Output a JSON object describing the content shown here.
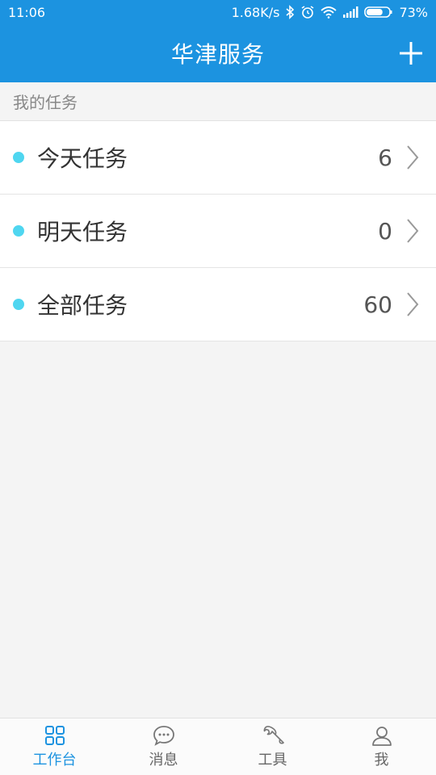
{
  "status_bar": {
    "time": "11:06",
    "network_speed": "1.68K/s",
    "battery": "73%",
    "battery_level": 0.73
  },
  "app_bar": {
    "title": "华津服务",
    "add_icon": "plus-icon"
  },
  "section": {
    "title": "我的任务"
  },
  "tasks": [
    {
      "label": "今天任务",
      "count": "6"
    },
    {
      "label": "明天任务",
      "count": "0"
    },
    {
      "label": "全部任务",
      "count": "60"
    }
  ],
  "tabs": [
    {
      "label": "工作台",
      "icon": "grid-icon",
      "active": true
    },
    {
      "label": "消息",
      "icon": "chat-bubble-icon",
      "active": false
    },
    {
      "label": "工具",
      "icon": "wrench-icon",
      "active": false
    },
    {
      "label": "我",
      "icon": "person-icon",
      "active": false
    }
  ],
  "colors": {
    "primary": "#1c93e0",
    "dot": "#4fd6f0",
    "background": "#f4f4f4"
  }
}
